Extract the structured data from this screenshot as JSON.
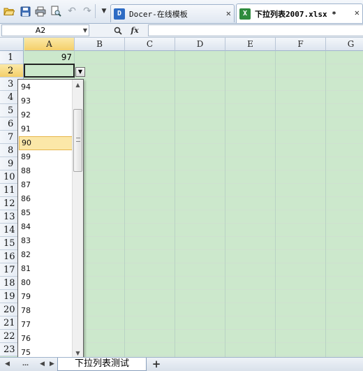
{
  "toolbar": {
    "icons": [
      "open-folder-icon",
      "save-icon",
      "print-icon",
      "print-preview-icon",
      "undo-icon",
      "redo-icon",
      "customize-toolbar-icon"
    ]
  },
  "tabs": [
    {
      "label": "Docer-在线模板",
      "icon": "docer-icon",
      "active": false,
      "close": "✕"
    },
    {
      "label": "下拉列表2007.xlsx *",
      "icon": "xlsx-icon",
      "active": true,
      "close": "✕"
    }
  ],
  "formula_bar": {
    "name_box": "A2",
    "formula": ""
  },
  "grid": {
    "columns": [
      "A",
      "B",
      "C",
      "D",
      "E",
      "F",
      "G"
    ],
    "selected_column": "A",
    "rows": [
      "1",
      "2",
      "3",
      "4",
      "5",
      "6",
      "7",
      "8",
      "9",
      "10",
      "11",
      "12",
      "13",
      "14",
      "15",
      "16",
      "17",
      "18",
      "19",
      "20",
      "21",
      "22",
      "23"
    ],
    "selected_row": "2",
    "cells": {
      "A1": "97",
      "A2": ""
    },
    "cell_background": "#cce8cc"
  },
  "dropdown": {
    "items": [
      "94",
      "93",
      "92",
      "91",
      "90",
      "89",
      "88",
      "87",
      "86",
      "85",
      "84",
      "83",
      "82",
      "81",
      "80",
      "79",
      "78",
      "77",
      "76",
      "75"
    ],
    "highlighted": "90",
    "highlight_color": "#fbe7a8"
  },
  "sheet_bar": {
    "tabs": [
      "下拉列表测试"
    ],
    "add_symbol": "+"
  }
}
